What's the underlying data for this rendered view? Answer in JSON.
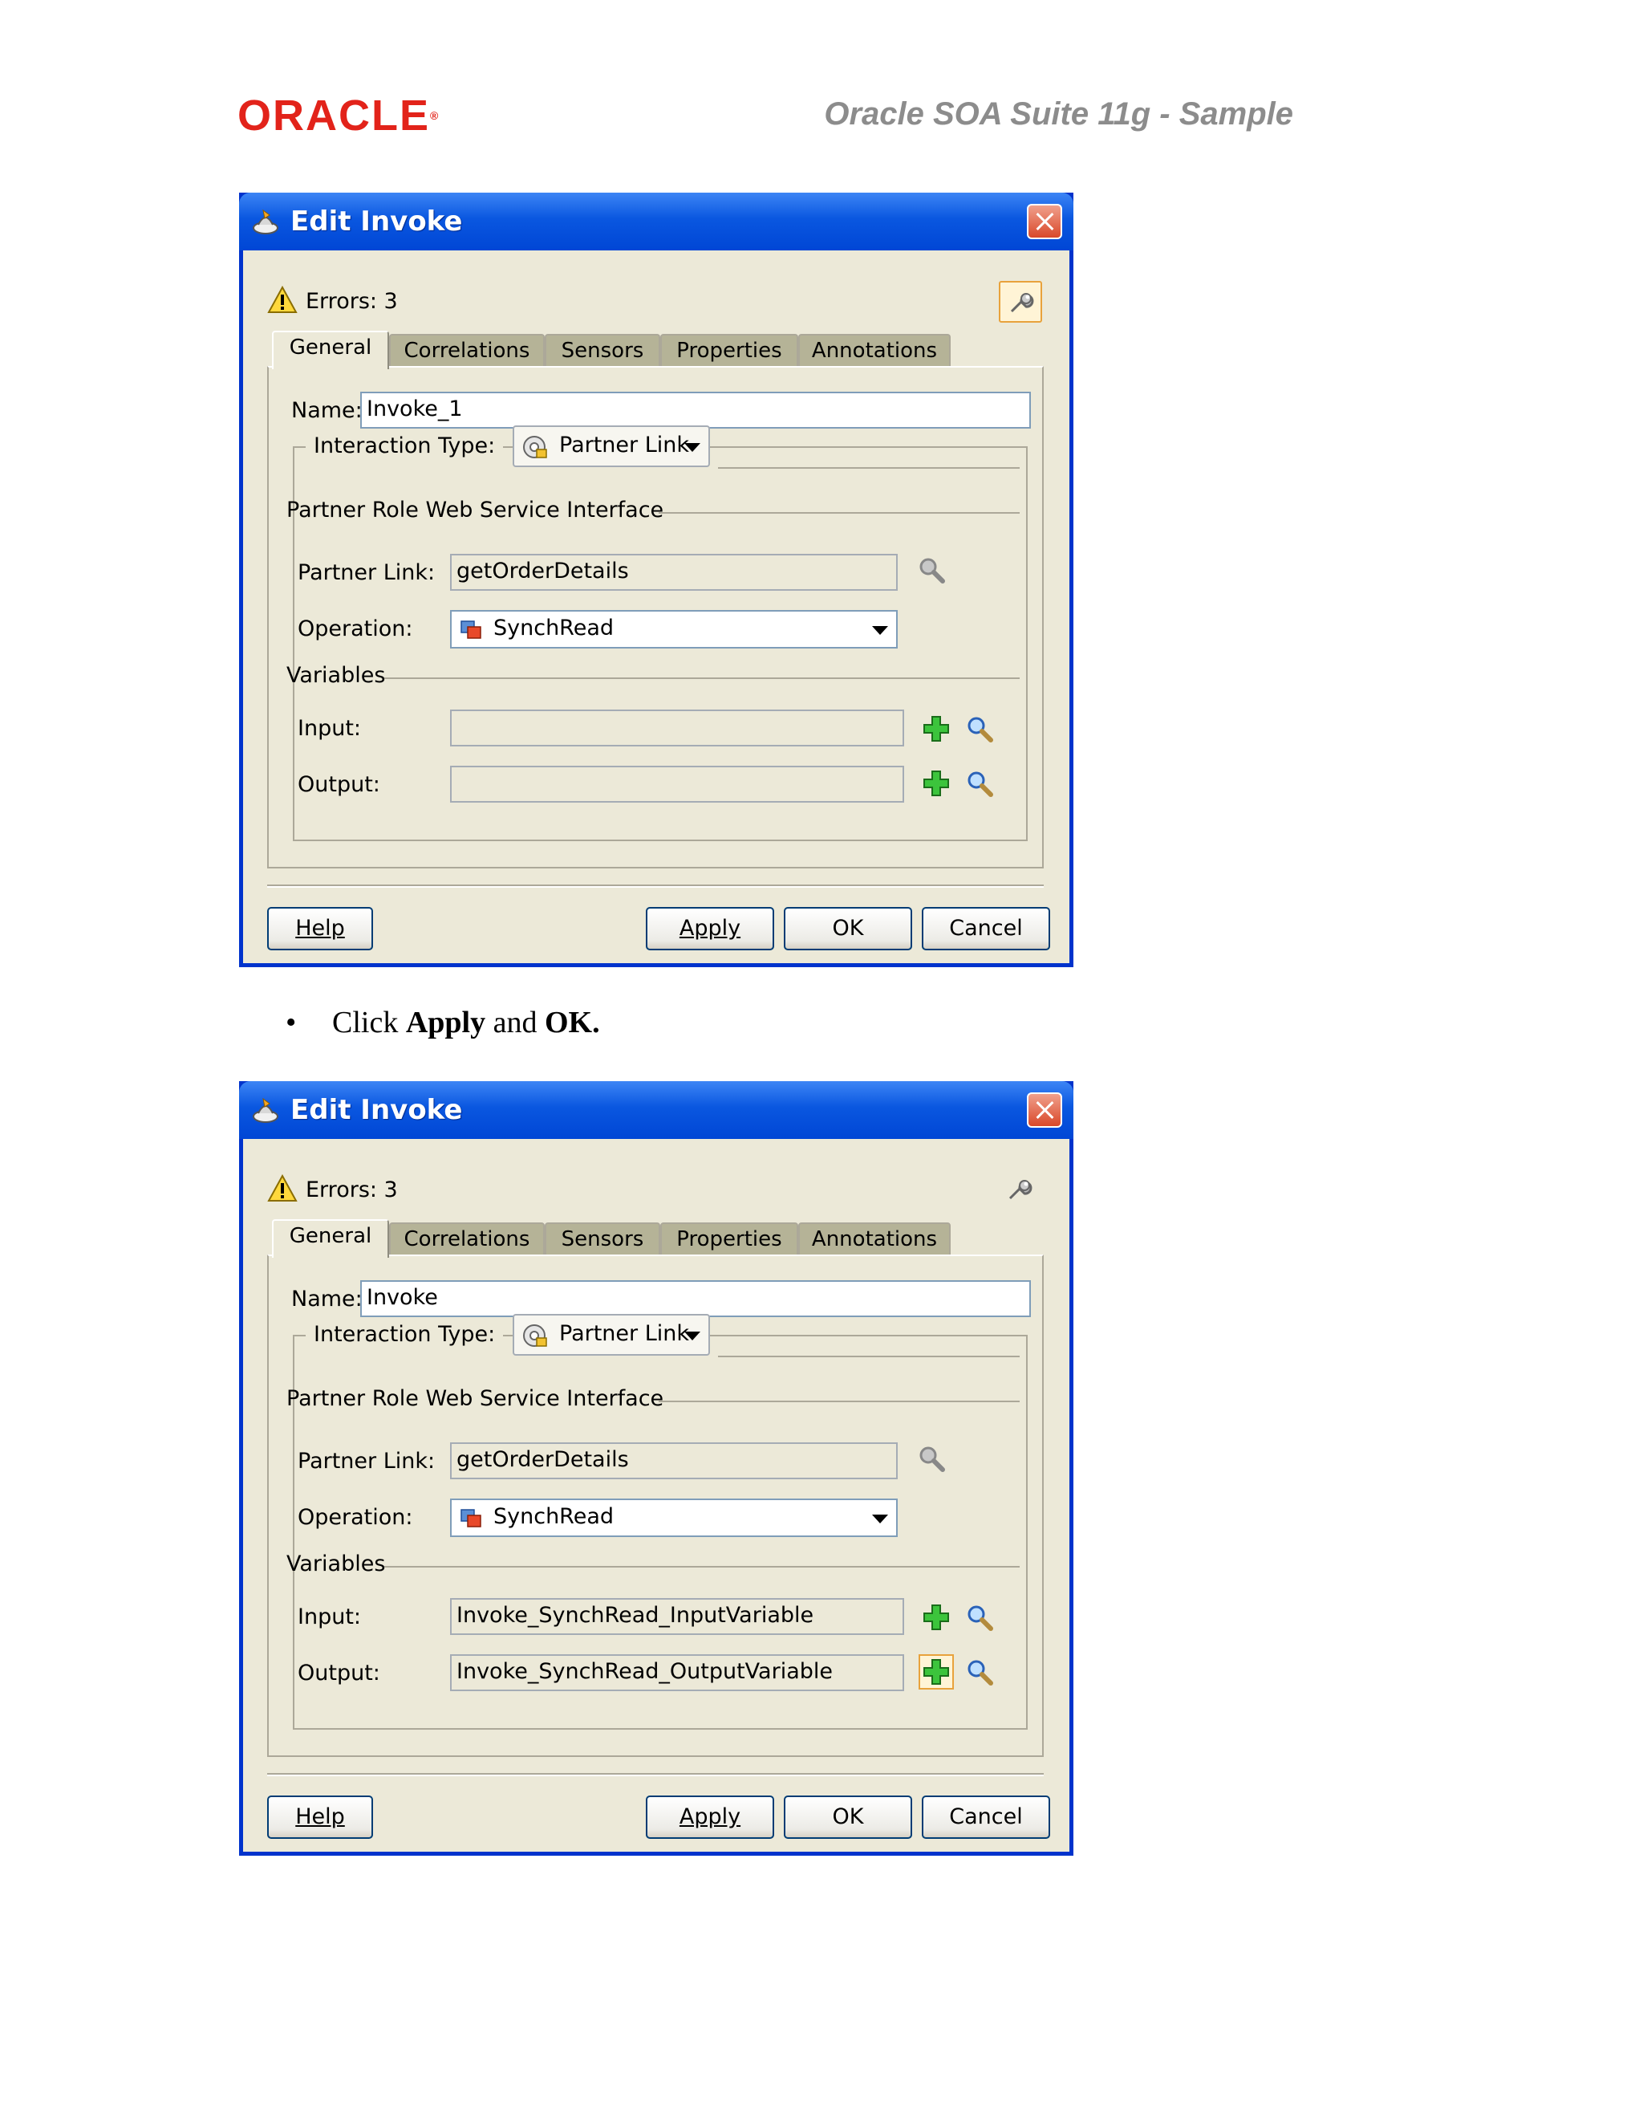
{
  "header": {
    "logo": "ORACLE",
    "title": "Oracle SOA Suite 11g - Sample"
  },
  "dialogs": [
    {
      "title": "Edit Invoke",
      "errors": "Errors: 3",
      "tabs": [
        "General",
        "Correlations",
        "Sensors",
        "Properties",
        "Annotations"
      ],
      "name_label": "Name:",
      "name_value": "Invoke_1",
      "interaction_label": "Interaction Type:",
      "interaction_value": "Partner Link",
      "group_title": "Partner Role Web Service Interface",
      "partner_link_label": "Partner Link:",
      "partner_link_value": "getOrderDetails",
      "operation_label": "Operation:",
      "operation_value": "SynchRead",
      "variables_label": "Variables",
      "input_label": "Input:",
      "input_value": "",
      "output_label": "Output:",
      "output_value": "",
      "buttons": {
        "help": "Help",
        "apply": "Apply",
        "ok": "OK",
        "cancel": "Cancel"
      }
    },
    {
      "title": "Edit Invoke",
      "errors": "Errors: 3",
      "tabs": [
        "General",
        "Correlations",
        "Sensors",
        "Properties",
        "Annotations"
      ],
      "name_label": "Name:",
      "name_value": "Invoke",
      "interaction_label": "Interaction Type:",
      "interaction_value": "Partner Link",
      "group_title": "Partner Role Web Service Interface",
      "partner_link_label": "Partner Link:",
      "partner_link_value": "getOrderDetails",
      "operation_label": "Operation:",
      "operation_value": "SynchRead",
      "variables_label": "Variables",
      "input_label": "Input:",
      "input_value": "Invoke_SynchRead_InputVariable",
      "output_label": "Output:",
      "output_value": "Invoke_SynchRead_OutputVariable",
      "buttons": {
        "help": "Help",
        "apply": "Apply",
        "ok": "OK",
        "cancel": "Cancel"
      }
    }
  ],
  "instruction": {
    "prefix": "Click ",
    "apply": "Apply",
    "middle": " and ",
    "ok": "OK."
  },
  "colors": {
    "oracle_red": "#e2231a",
    "title_blue": "#0046d5",
    "dialog_bg": "#ece9d8"
  }
}
